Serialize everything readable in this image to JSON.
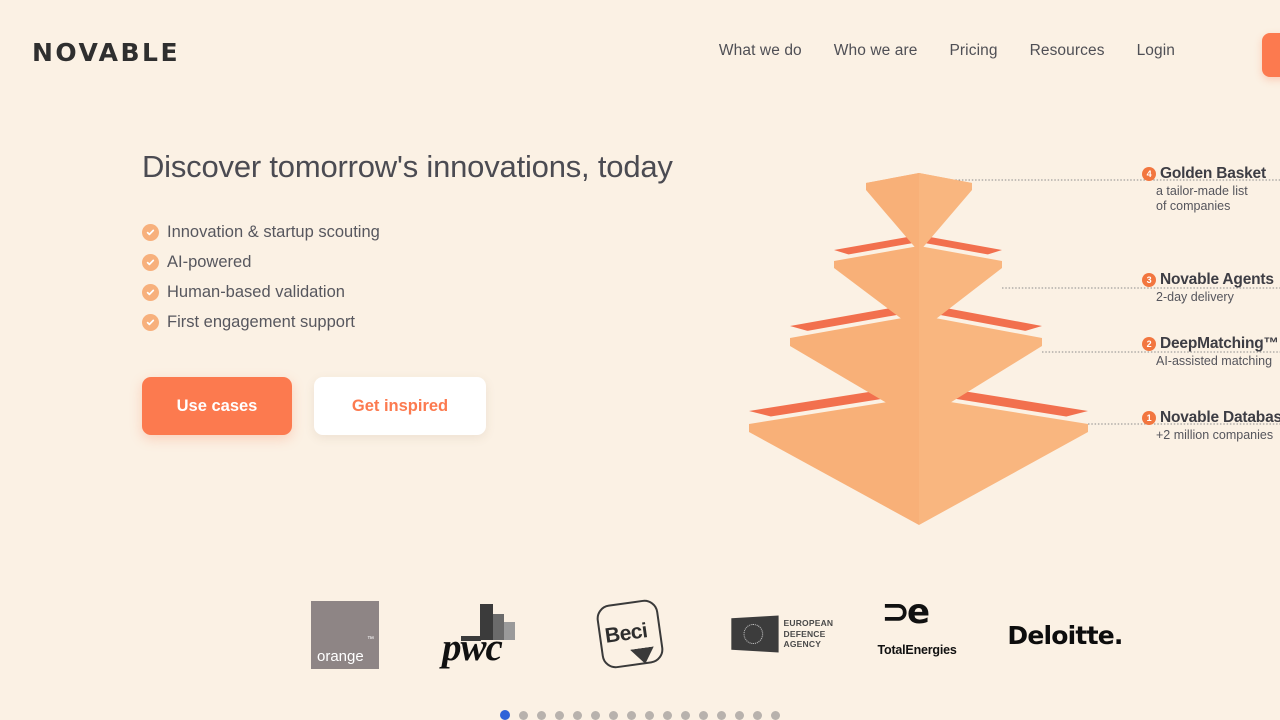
{
  "brand": {
    "logo_text": "NOVABLE"
  },
  "nav": {
    "items": [
      {
        "label": "What we do"
      },
      {
        "label": "Who we are"
      },
      {
        "label": "Pricing"
      },
      {
        "label": "Resources"
      },
      {
        "label": "Login"
      }
    ],
    "cta_label": ""
  },
  "hero": {
    "title": "Discover tomorrow's innovations, today",
    "features": [
      {
        "label": "Innovation & startup scouting"
      },
      {
        "label": "AI-powered"
      },
      {
        "label": "Human-based validation"
      },
      {
        "label": "First engagement support"
      }
    ],
    "primary_cta": "Use cases",
    "secondary_cta": "Get inspired"
  },
  "pyramid": {
    "layers": [
      {
        "badge": "4",
        "title": "Golden Basket",
        "subtitle_line1": "a tailor-made list",
        "subtitle_line2": "of companies"
      },
      {
        "badge": "3",
        "title": "Novable Agents",
        "subtitle_line1": "2-day delivery",
        "subtitle_line2": ""
      },
      {
        "badge": "2",
        "title": "DeepMatching™",
        "subtitle_line1": "AI-assisted matching",
        "subtitle_line2": ""
      },
      {
        "badge": "1",
        "title": "Novable Database",
        "subtitle_line1": "+2 million companies",
        "subtitle_line2": ""
      }
    ]
  },
  "logos": {
    "items": [
      {
        "name": "orange",
        "label": "orange",
        "tm": "™"
      },
      {
        "name": "pwc",
        "label": "pwc"
      },
      {
        "name": "beci",
        "label": "Beci"
      },
      {
        "name": "european-defence-agency",
        "line1": "EUROPEAN",
        "line2": "DEFENCE",
        "line3": "AGENCY"
      },
      {
        "name": "totalenergies",
        "mark": "⊃e",
        "label": "TotalEnergies"
      },
      {
        "name": "deloitte",
        "label": "Deloitte."
      }
    ]
  },
  "carousel": {
    "total_dots": 16,
    "active_index": 0,
    "active_color": "#2f63d8",
    "inactive_color": "#b8b2ad"
  },
  "theme": {
    "background": "#fbf1e4",
    "accent": "#fc7a4f",
    "accent_light": "#f8b078",
    "accent_dark": "#f2704e",
    "text": "#4b4b52"
  }
}
